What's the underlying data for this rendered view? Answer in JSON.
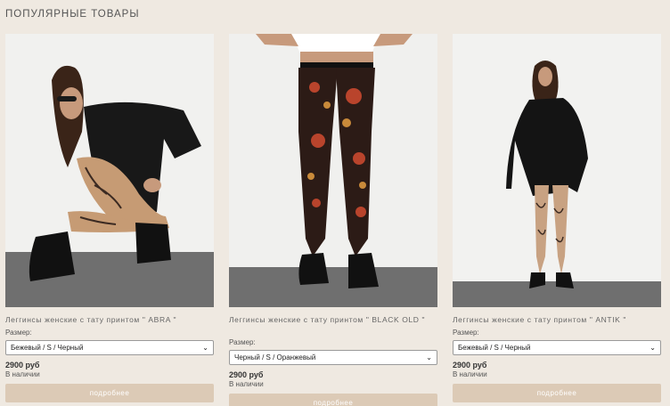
{
  "section": {
    "title": "ПОПУЛЯРНЫЕ ТОВАРЫ"
  },
  "products": [
    {
      "name": "Леггинсы женские с тату принтом \" ABRA \"",
      "size_label": "Размер:",
      "selected_option": "Бежевый / S / Черный",
      "price": "2900 руб",
      "stock": "В наличии",
      "button": "подробнее"
    },
    {
      "name": "Леггинсы женские с тату принтом \" BLACK OLD \"",
      "size_label": "Размер:",
      "selected_option": "Черный / S / Оранжевый",
      "price": "2900 руб",
      "stock": "В наличии",
      "button": "подробнее"
    },
    {
      "name": "Леггинсы женские с тату принтом \" ANTIK \"",
      "size_label": "Размер:",
      "selected_option": "Бежевый / S / Черный",
      "price": "2900 руб",
      "stock": "В наличии",
      "button": "подробнее"
    }
  ],
  "icons": {
    "select_arrow": "chevron-down-icon"
  }
}
